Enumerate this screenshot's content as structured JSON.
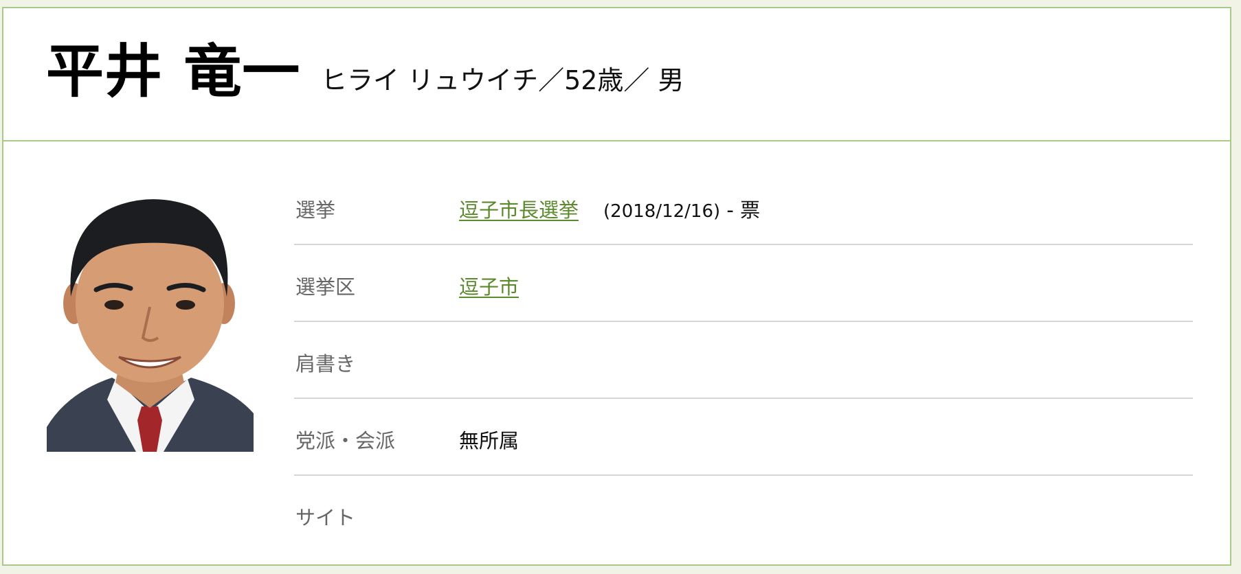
{
  "profile": {
    "name": "平井 竜一",
    "meta": "ヒライ リュウイチ／52歳／ 男"
  },
  "details": {
    "election": {
      "label": "選挙",
      "link": "逗子市長選挙",
      "date": "(2018/12/16)",
      "votes": " - 票"
    },
    "district": {
      "label": "選挙区",
      "link": "逗子市"
    },
    "title": {
      "label": "肩書き",
      "value": ""
    },
    "party": {
      "label": "党派・会派",
      "value": "無所属"
    },
    "site": {
      "label": "サイト",
      "value": ""
    }
  },
  "colors": {
    "border": "#a9c98a",
    "link": "#5a8a2b",
    "label": "#666666",
    "divider": "#d6d6d6"
  }
}
